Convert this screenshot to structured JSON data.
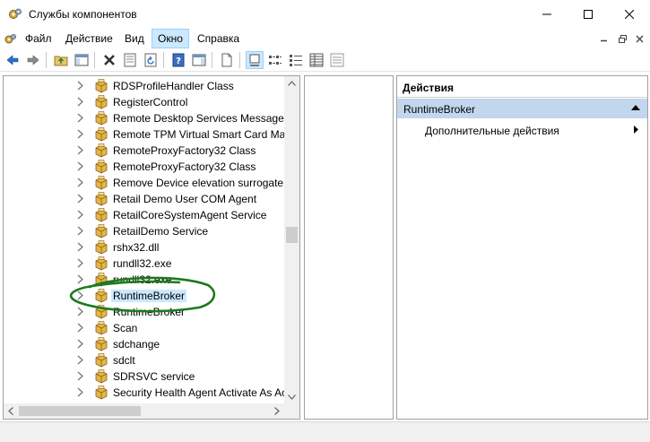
{
  "window": {
    "title": "Службы компонентов"
  },
  "menu": {
    "items": [
      {
        "label": "Файл",
        "active": false
      },
      {
        "label": "Действие",
        "active": false
      },
      {
        "label": "Вид",
        "active": false
      },
      {
        "label": "Окно",
        "active": true
      },
      {
        "label": "Справка",
        "active": false
      }
    ]
  },
  "tree": {
    "items": [
      {
        "label": "RDSProfileHandler Class"
      },
      {
        "label": "RegisterControl"
      },
      {
        "label": "Remote Desktop Services Message Se"
      },
      {
        "label": "Remote TPM Virtual Smart Card Man"
      },
      {
        "label": "RemoteProxyFactory32 Class"
      },
      {
        "label": "RemoteProxyFactory32 Class"
      },
      {
        "label": "Remove Device elevation surrogate"
      },
      {
        "label": "Retail Demo User COM Agent"
      },
      {
        "label": "RetailCoreSystemAgent Service"
      },
      {
        "label": "RetailDemo Service"
      },
      {
        "label": "rshx32.dll"
      },
      {
        "label": "rundll32.exe"
      },
      {
        "label": "rundll32.exe"
      },
      {
        "label": "RuntimeBroker",
        "selected": true
      },
      {
        "label": "RuntimeBroker"
      },
      {
        "label": "Scan"
      },
      {
        "label": "sdchange"
      },
      {
        "label": "sdclt"
      },
      {
        "label": "SDRSVC service"
      },
      {
        "label": "Security Health Agent Activate As Ac"
      }
    ]
  },
  "actions": {
    "header": "Действия",
    "section_title": "RuntimeBroker",
    "more_actions": "Дополнительные действия"
  },
  "colors": {
    "selection": "#cce8ff",
    "section_bg": "#c2d7ee",
    "annotation": "#1e7a1e"
  }
}
